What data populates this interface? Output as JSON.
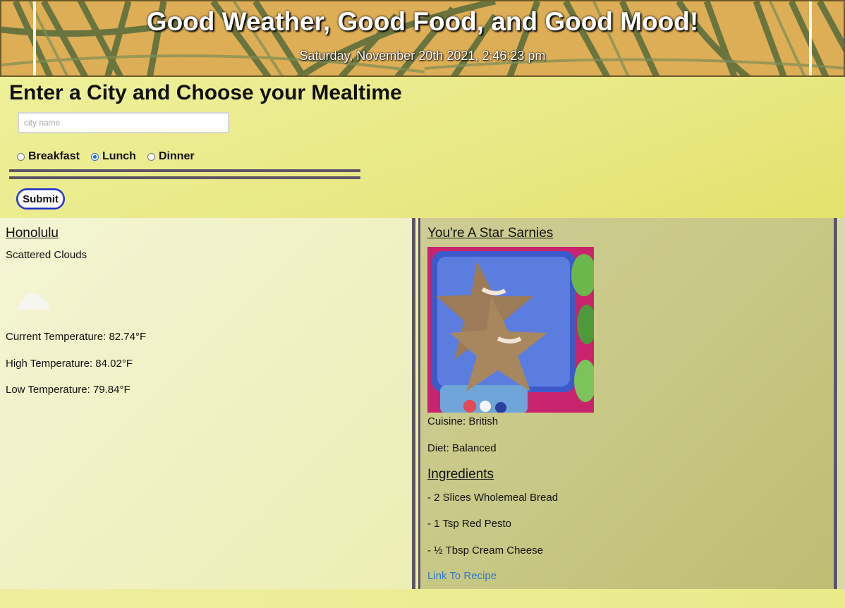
{
  "header": {
    "title": "Good Weather, Good Food, and Good Mood!",
    "datetime": "Saturday, November 20th 2021, 2:46:23 pm"
  },
  "form": {
    "heading": "Enter a City and Choose your Mealtime",
    "city_placeholder": "city name",
    "city_value": "",
    "meal_options": [
      {
        "label": "Breakfast",
        "checked": false
      },
      {
        "label": "Lunch",
        "checked": true
      },
      {
        "label": "Dinner",
        "checked": false
      }
    ],
    "submit_label": "Submit"
  },
  "weather": {
    "city": "Honolulu",
    "description": "Scattered Clouds",
    "icon": "cloud-icon",
    "current_temp": "Current Temperature: 82.74°F",
    "high_temp": "High Temperature: 84.02°F",
    "low_temp": "Low Temperature: 79.84°F"
  },
  "recipe": {
    "title": "You're A Star Sarnies",
    "image": "star-sandwich-lunchbox-image",
    "cuisine": "Cuisine: British",
    "diet": "Diet: Balanced",
    "ingredients_heading": "Ingredients",
    "ingredients": [
      "- 2 Slices Wholemeal Bread",
      "- 1 Tsp Red Pesto",
      "- ½ Tbsp Cream Cheese"
    ],
    "link_label": "Link To Recipe"
  },
  "colors": {
    "divider": "#5d5467",
    "link": "#2f79c8",
    "radio_accent": "#1a66e8",
    "submit_border": "#1c2fc7"
  }
}
